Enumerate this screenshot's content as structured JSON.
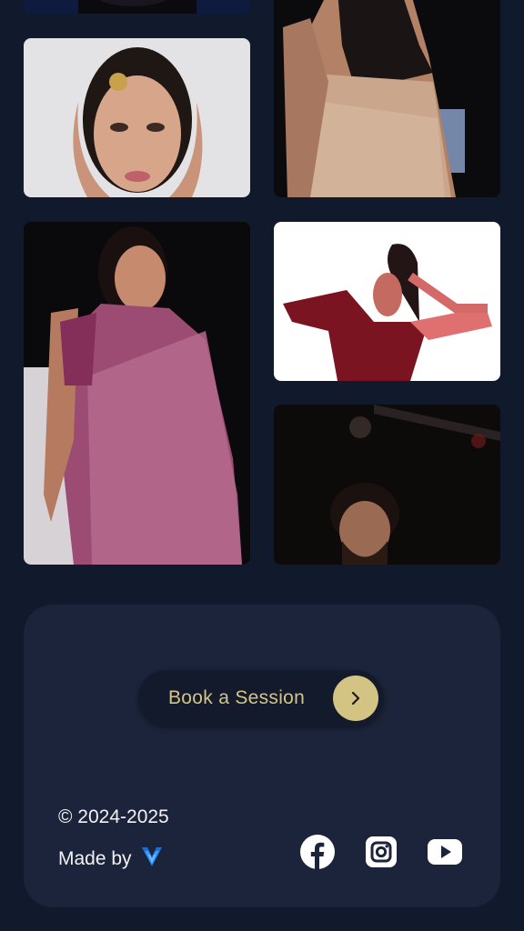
{
  "cta": {
    "label": "Book a Session",
    "icon": "chevron-right-icon"
  },
  "footer": {
    "copyright": "© 2024-2025",
    "made_by": "Made by"
  },
  "social": [
    "facebook-icon",
    "instagram-icon",
    "youtube-icon"
  ],
  "colors": {
    "background": "#111a2c",
    "card": "#1b243a",
    "accent": "#d4c483",
    "youtube": "#ffffff"
  }
}
